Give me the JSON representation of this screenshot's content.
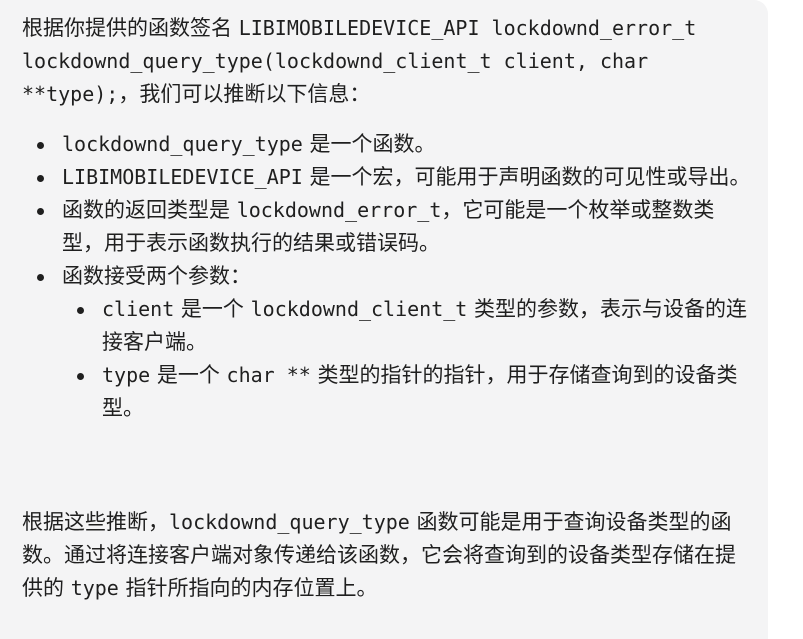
{
  "intro": {
    "t1": "根据你提供的函数签名 ",
    "sig": "LIBIMOBILEDEVICE_API lockdownd_error_t lockdownd_query_type(lockdownd_client_t client, char **type);",
    "t2": "，我们可以推断以下信息："
  },
  "bullets": {
    "b1": {
      "code": "lockdownd_query_type",
      "text": " 是一个函数。"
    },
    "b2": {
      "code": "LIBIMOBILEDEVICE_API",
      "text": " 是一个宏，可能用于声明函数的可见性或导出。"
    },
    "b3": {
      "pre": "函数的返回类型是 ",
      "code": "lockdownd_error_t",
      "text": "，它可能是一个枚举或整数类型，用于表示函数执行的结果或错误码。"
    },
    "b4": {
      "text": "函数接受两个参数：",
      "sub1": {
        "code": "client",
        "mid": " 是一个 ",
        "code2": "lockdownd_client_t",
        "text": " 类型的参数，表示与设备的连接客户端。"
      },
      "sub2": {
        "code": "type",
        "mid": " 是一个 ",
        "code2": "char **",
        "text": " 类型的指针的指针，用于存储查询到的设备类型。"
      }
    }
  },
  "conclusion": {
    "t1": "根据这些推断，",
    "code": "lockdownd_query_type",
    "t2": " 函数可能是用于查询设备类型的函数。通过将连接客户端对象传递给该函数，它会将查询到的设备类型存储在提供的 ",
    "code2": "type",
    "t3": " 指针所指向的内存位置上。"
  }
}
